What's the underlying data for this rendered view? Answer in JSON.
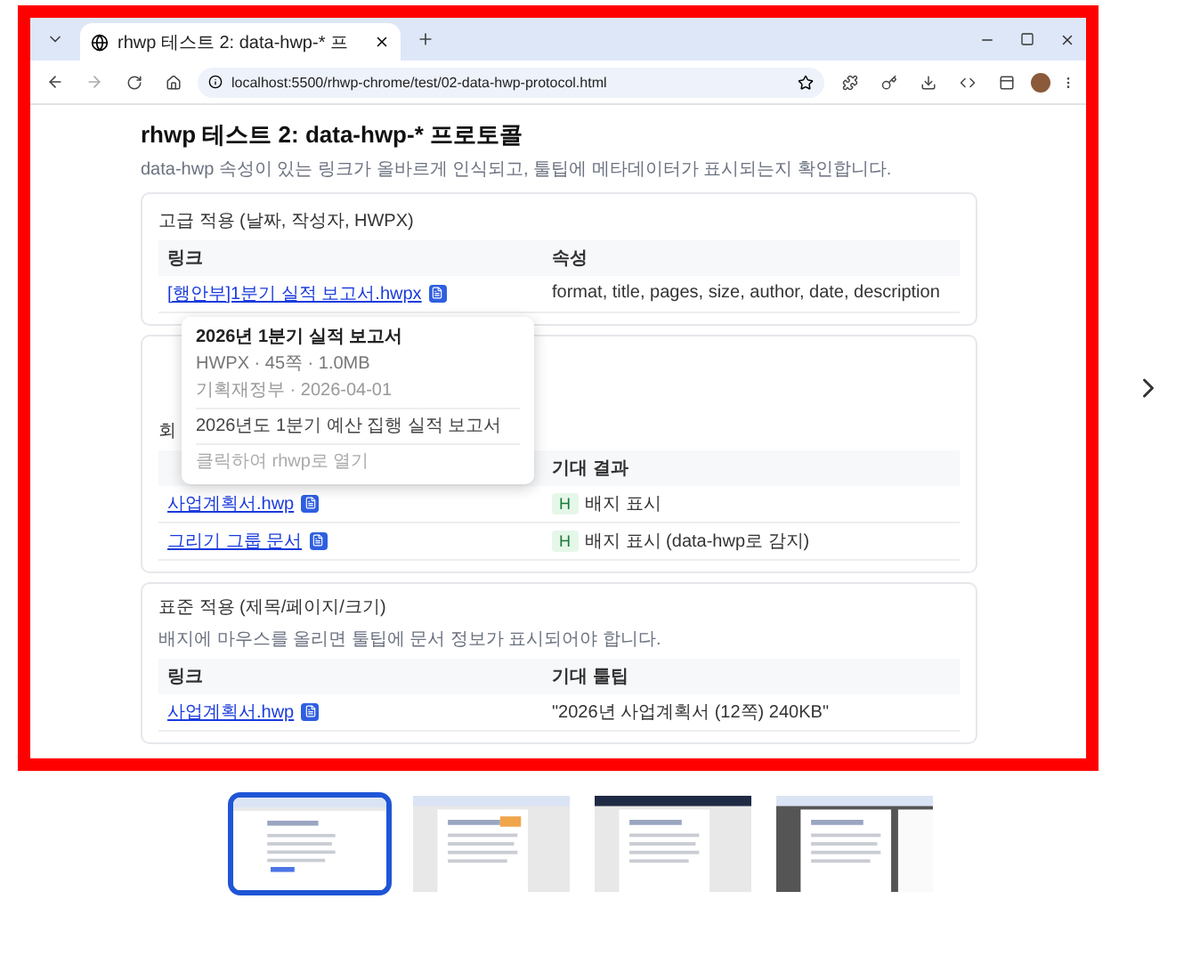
{
  "browser": {
    "tab_title": "rhwp 테스트 2: data-hwp-* 프",
    "url": "localhost:5500/rhwp-chrome/test/02-data-hwp-protocol.html"
  },
  "page": {
    "title": "rhwp 테스트 2: data-hwp-* 프로토콜",
    "subtitle": "data-hwp 속성이 있는 링크가 올바르게 인식되고, 툴팁에 메타데이터가 표시되는지 확인합니다.",
    "sections": [
      {
        "title": "고급 적용 (날짜, 작성자, HWPX)",
        "columns": [
          "링크",
          "속성"
        ],
        "rows": [
          {
            "link": "[행안부]1분기 실적 보고서.hwpx",
            "value": "format, title, pages, size, author, date, description"
          }
        ]
      },
      {
        "title": "회",
        "columns": [
          "기대 결과"
        ],
        "rows": [
          {
            "link": "사업계획서.hwp",
            "tag": "H",
            "value": "배지 표시"
          },
          {
            "link": "그리기 그룹 문서",
            "tag": "H",
            "value": "배지 표시 (data-hwp로 감지)"
          }
        ]
      },
      {
        "title": "표준 적용 (제목/페이지/크기)",
        "note": "배지에 마우스를 올리면 툴팁에 문서 정보가 표시되어야 합니다.",
        "columns": [
          "링크",
          "기대 툴팁"
        ],
        "rows": [
          {
            "link": "사업계획서.hwp",
            "value": "\"2026년 사업계획서 (12쪽) 240KB\""
          }
        ]
      }
    ],
    "tooltip": {
      "title": "2026년 1분기 실적 보고서",
      "meta": "HWPX · 45쪽 · 1.0MB",
      "source": "기획재정부 · 2026-04-01",
      "description": "2026년도 1분기 예산 집행 실적 보고서",
      "hint": "클릭하여 rhwp로 열기"
    }
  },
  "thumbnails": [
    {
      "kind": "picture",
      "selected": true
    },
    {
      "kind": "picture",
      "selected": false
    },
    {
      "kind": "picture",
      "selected": false
    },
    {
      "kind": "picture",
      "selected": false
    }
  ]
}
